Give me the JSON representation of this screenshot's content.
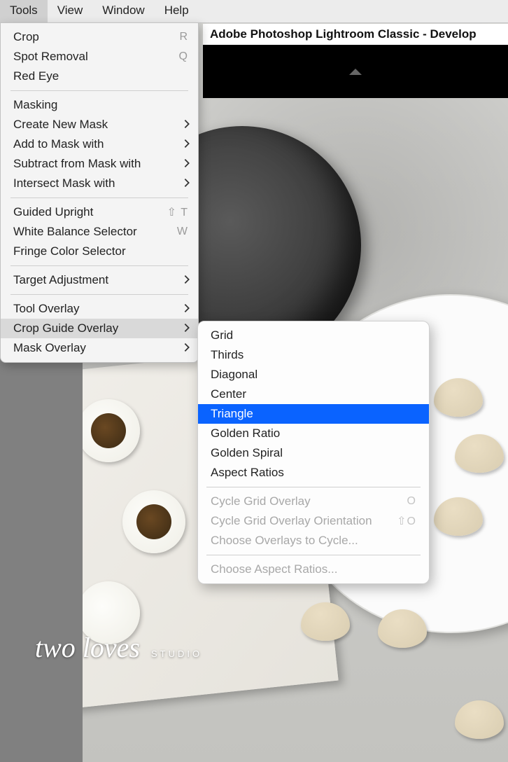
{
  "menubar": {
    "items": [
      {
        "label": "Tools",
        "active": true
      },
      {
        "label": "View"
      },
      {
        "label": "Window"
      },
      {
        "label": "Help"
      }
    ]
  },
  "window_title": "Adobe Photoshop Lightroom Classic - Develop",
  "tools_menu": {
    "crop": {
      "label": "Crop",
      "shortcut": "R"
    },
    "spot_removal": {
      "label": "Spot Removal",
      "shortcut": "Q"
    },
    "red_eye": {
      "label": "Red Eye"
    },
    "masking": {
      "label": "Masking"
    },
    "create_new_mask": {
      "label": "Create New Mask",
      "submenu": true
    },
    "add_to_mask": {
      "label": "Add to Mask with",
      "submenu": true
    },
    "subtract_from_mask": {
      "label": "Subtract from Mask with",
      "submenu": true
    },
    "intersect_mask": {
      "label": "Intersect Mask with",
      "submenu": true
    },
    "guided_upright": {
      "label": "Guided Upright",
      "shortcut": "⇧ T"
    },
    "wb_selector": {
      "label": "White Balance Selector",
      "shortcut": "W"
    },
    "fringe_selector": {
      "label": "Fringe Color Selector"
    },
    "target_adjustment": {
      "label": "Target Adjustment",
      "submenu": true
    },
    "tool_overlay": {
      "label": "Tool Overlay",
      "submenu": true
    },
    "crop_guide_overlay": {
      "label": "Crop Guide Overlay",
      "submenu": true,
      "hovered": true
    },
    "mask_overlay": {
      "label": "Mask Overlay",
      "submenu": true
    }
  },
  "crop_guide_submenu": {
    "grid": {
      "label": "Grid"
    },
    "thirds": {
      "label": "Thirds"
    },
    "diagonal": {
      "label": "Diagonal"
    },
    "center": {
      "label": "Center"
    },
    "triangle": {
      "label": "Triangle",
      "selected": true
    },
    "golden_ratio": {
      "label": "Golden Ratio"
    },
    "golden_spiral": {
      "label": "Golden Spiral"
    },
    "aspect_ratios": {
      "label": "Aspect Ratios"
    },
    "cycle_overlay": {
      "label": "Cycle Grid Overlay",
      "shortcut": "O",
      "disabled": true
    },
    "cycle_orientation": {
      "label": "Cycle Grid Overlay Orientation",
      "shortcut": "⇧O",
      "disabled": true
    },
    "choose_overlays": {
      "label": "Choose Overlays to Cycle...",
      "disabled": true
    },
    "choose_aspect_ratios": {
      "label": "Choose Aspect Ratios...",
      "disabled": true
    }
  },
  "watermark": {
    "line1": "two loves",
    "line2": "STUDIO"
  }
}
